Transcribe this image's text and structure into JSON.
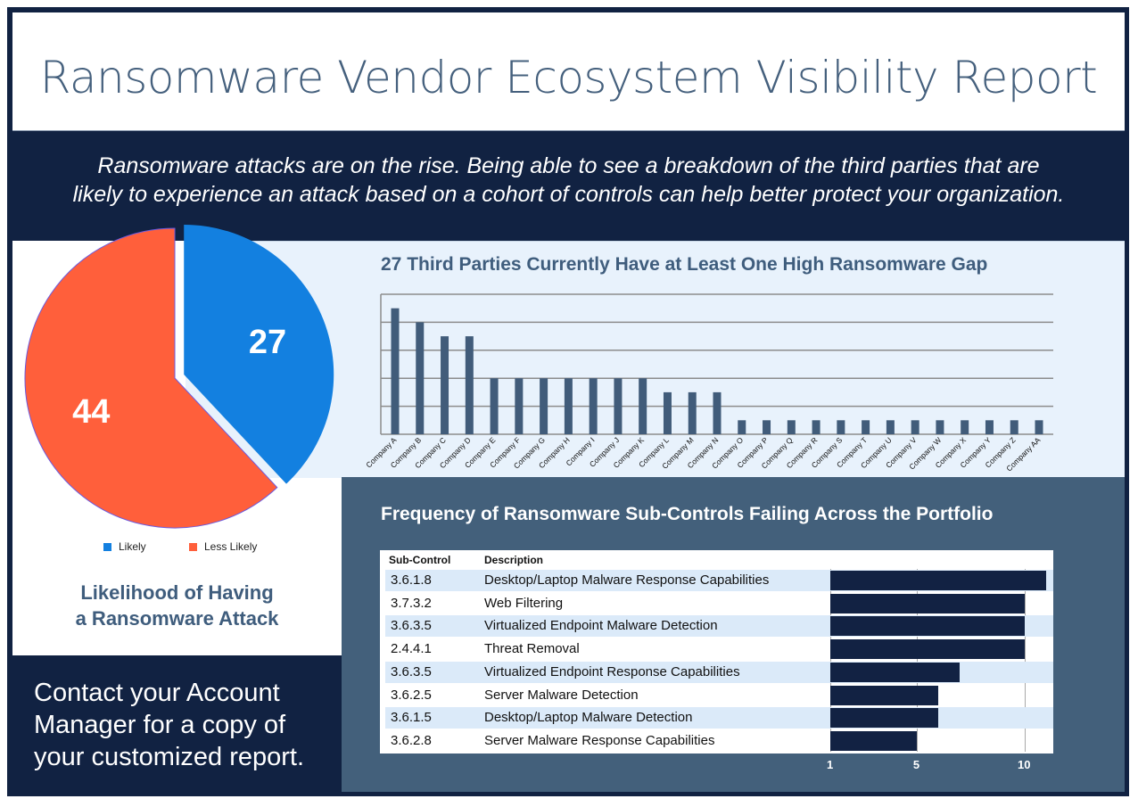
{
  "header": {
    "title": "Ransomware Vendor Ecosystem Visibility Report",
    "intro_line1": "Ransomware attacks are on the rise. Being able to see a breakdown of the third parties that are",
    "intro_line2": "likely to experience an attack based on a cohort of controls can help better protect your organization."
  },
  "contact": {
    "line1": "Contact your Account",
    "line2": "Manager for a copy of",
    "line3": "your customized report."
  },
  "colors": {
    "navy": "#112242",
    "slate": "#43607b",
    "likely": "#1380e0",
    "less_likely": "#ff5f3b",
    "bar": "#415c7a",
    "light_panel": "#e8f2fc"
  },
  "chart_data": [
    {
      "type": "pie",
      "title": "Likelihood of Having a Ransomware Attack",
      "title_line1": "Likelihood of Having",
      "title_line2": "a Ransomware Attack",
      "slices": [
        {
          "label": "Likely",
          "value": 27,
          "color": "#1380e0",
          "exploded": true
        },
        {
          "label": "Less Likely",
          "value": 44,
          "color": "#ff5f3b",
          "exploded": false
        }
      ],
      "legend": [
        "Likely",
        "Less Likely"
      ],
      "legend_position": "bottom"
    },
    {
      "type": "bar",
      "title": "27 Third Parties Currently Have at Least One High Ransomware Gap",
      "categories": [
        "Company A",
        "Company B",
        "Company C",
        "Company D",
        "Company E",
        "Company F",
        "Company G",
        "Company H",
        "Company I",
        "Company J",
        "Company K",
        "Company L",
        "Company M",
        "Company N",
        "Company O",
        "Company P",
        "Company Q",
        "Company R",
        "Company S",
        "Company T",
        "Company U",
        "Company V",
        "Company W",
        "Company X",
        "Company Y",
        "Company Z",
        "Company AA"
      ],
      "values": [
        9,
        8,
        7,
        7,
        4,
        4,
        4,
        4,
        4,
        4,
        4,
        3,
        3,
        3,
        1,
        1,
        1,
        1,
        1,
        1,
        1,
        1,
        1,
        1,
        1,
        1,
        1
      ],
      "ylim": [
        0,
        10
      ],
      "ygrid_step": 2,
      "grid": true,
      "xlabel": "",
      "ylabel": ""
    },
    {
      "type": "table",
      "title": "Frequency of Ransomware Sub-Controls Failing Across the Portfolio",
      "columns": [
        "Sub-Control",
        "Description"
      ],
      "rows": [
        {
          "code": "3.6.1.8",
          "description": "Desktop/Laptop Malware Response Capabilities",
          "value": 11
        },
        {
          "code": "3.7.3.2",
          "description": "Web Filtering",
          "value": 10
        },
        {
          "code": "3.6.3.5",
          "description": "Virtualized Endpoint Malware Detection",
          "value": 10
        },
        {
          "code": "2.4.4.1",
          "description": "Threat Removal",
          "value": 10
        },
        {
          "code": "3.6.3.5",
          "description": "Virtualized Endpoint Response Capabilities",
          "value": 7
        },
        {
          "code": "3.6.2.5",
          "description": "Server Malware Detection",
          "value": 6
        },
        {
          "code": "3.6.1.5",
          "description": "Desktop/Laptop Malware Detection",
          "value": 6
        },
        {
          "code": "3.6.2.8",
          "description": "Server Malware Response Capabilities",
          "value": 5
        }
      ],
      "x_ticks": [
        "1",
        "5",
        "10"
      ],
      "xlim": [
        1,
        10
      ]
    }
  ]
}
